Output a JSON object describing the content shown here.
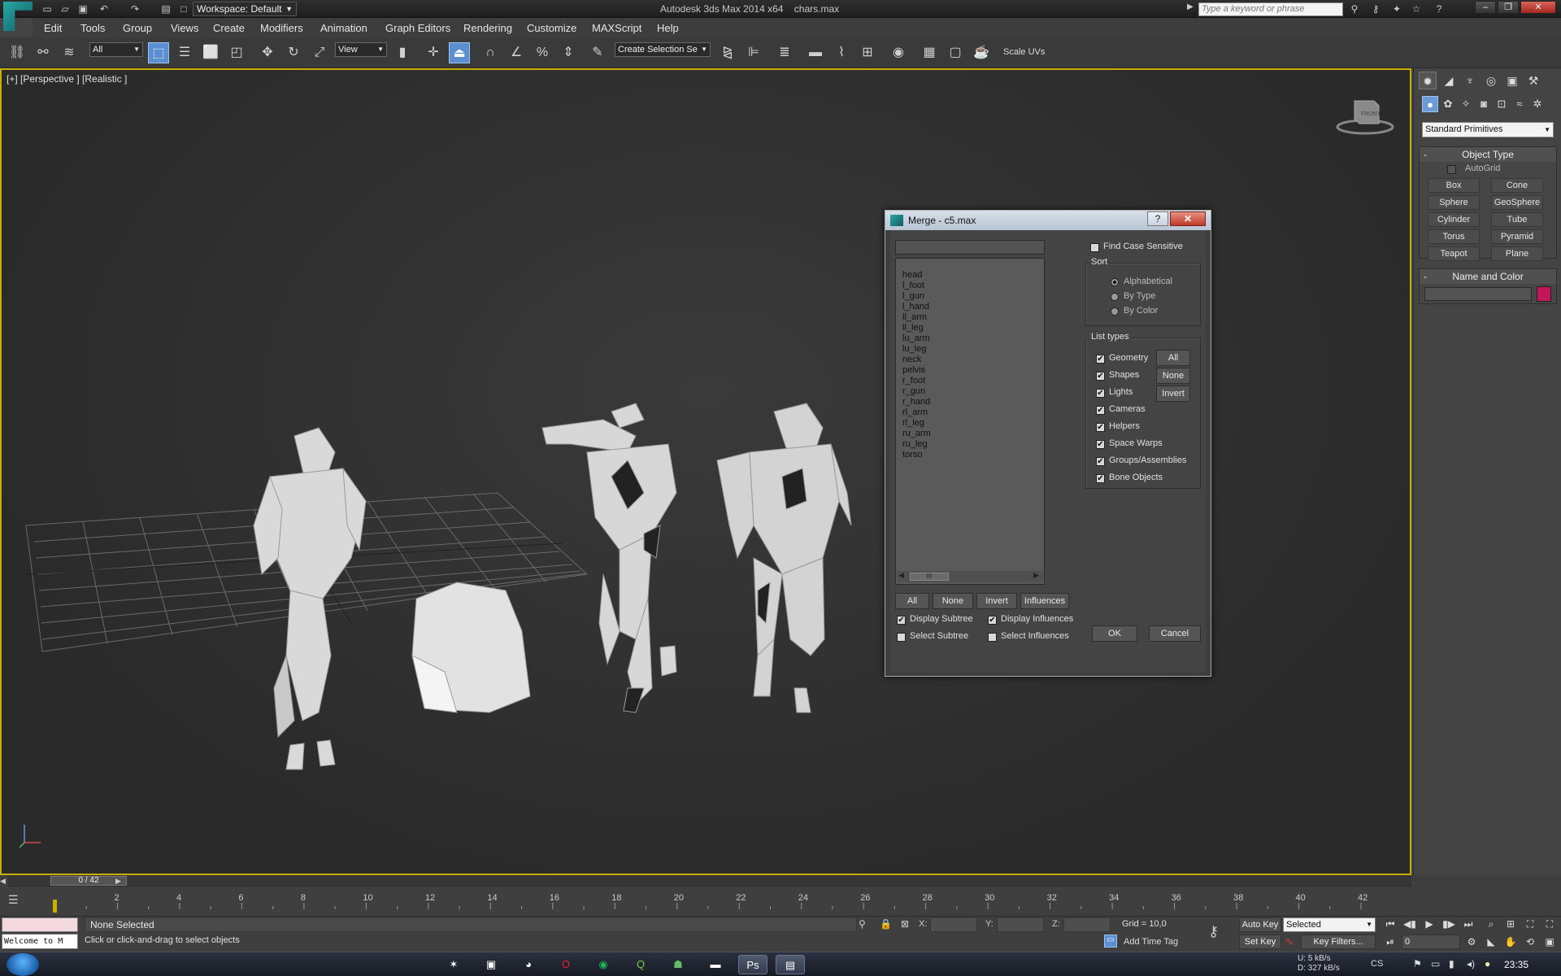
{
  "window": {
    "app_title": "Autodesk 3ds Max  2014 x64",
    "file_name": "chars.max",
    "workspace": "Workspace: Default",
    "search_placeholder": "Type a keyword or phrase"
  },
  "menu": [
    "Edit",
    "Tools",
    "Group",
    "Views",
    "Create",
    "Modifiers",
    "Animation",
    "Graph Editors",
    "Rendering",
    "Customize",
    "MAXScript",
    "Help"
  ],
  "toolbar": {
    "filter": "All",
    "ref_coord": "View",
    "selection_set": "Create Selection Se",
    "scale_uvs": "Scale UVs"
  },
  "viewport": {
    "label": "[+] [Perspective ] [Realistic ]",
    "viewcube_label": "FRONT"
  },
  "command_panel": {
    "category": "Standard Primitives",
    "object_type_title": "Object Type",
    "autogrid": "AutoGrid",
    "buttons": [
      "Box",
      "Cone",
      "Sphere",
      "GeoSphere",
      "Cylinder",
      "Tube",
      "Torus",
      "Pyramid",
      "Teapot",
      "Plane"
    ],
    "name_color_title": "Name and Color",
    "color": "#c2185b"
  },
  "dialog": {
    "title": "Merge - c5.max",
    "objects": [
      "head",
      "l_foot",
      "l_gun",
      "l_hand",
      "ll_arm",
      "ll_leg",
      "lu_arm",
      "lu_leg",
      "neck",
      "pelvis",
      "r_foot",
      "r_gun",
      "r_hand",
      "rl_arm",
      "rl_leg",
      "ru_arm",
      "ru_leg",
      "torso"
    ],
    "find_case_sensitive": "Find Case Sensitive",
    "sort_title": "Sort",
    "sort_options": [
      "Alphabetical",
      "By Type",
      "By Color"
    ],
    "sort_selected": "Alphabetical",
    "list_types_title": "List types",
    "list_types": [
      "Geometry",
      "Shapes",
      "Lights",
      "Cameras",
      "Helpers",
      "Space Warps",
      "Groups/Assemblies",
      "Bone Objects"
    ],
    "type_buttons": [
      "All",
      "None",
      "Invert"
    ],
    "list_buttons": [
      "All",
      "None",
      "Invert",
      "Influences"
    ],
    "display_subtree": "Display Subtree",
    "display_influences": "Display Influences",
    "select_subtree": "Select Subtree",
    "select_influences": "Select Influences",
    "ok": "OK",
    "cancel": "Cancel",
    "scroll_thumb": "III"
  },
  "timeline": {
    "slider": "0 / 42",
    "ticks": [
      "2",
      "4",
      "6",
      "8",
      "10",
      "12",
      "14",
      "16",
      "18",
      "20",
      "22",
      "24",
      "26",
      "28",
      "30",
      "32",
      "34",
      "36",
      "38",
      "40",
      "42"
    ]
  },
  "status": {
    "selection": "None Selected",
    "hint": "Click or click-and-drag to select objects",
    "welcome": "Welcome to M",
    "x_label": "X:",
    "y_label": "Y:",
    "z_label": "Z:",
    "grid": "Grid = 10,0",
    "auto_key": "Auto Key",
    "set_key": "Set Key",
    "selected": "Selected",
    "key_filters": "Key Filters...",
    "add_time_tag": "Add Time Tag",
    "frame": "0"
  },
  "taskbar": {
    "net_up": "U:       5 kB/s",
    "net_down": "D:   327 kB/s",
    "lang": "CS",
    "clock": "23:35"
  }
}
